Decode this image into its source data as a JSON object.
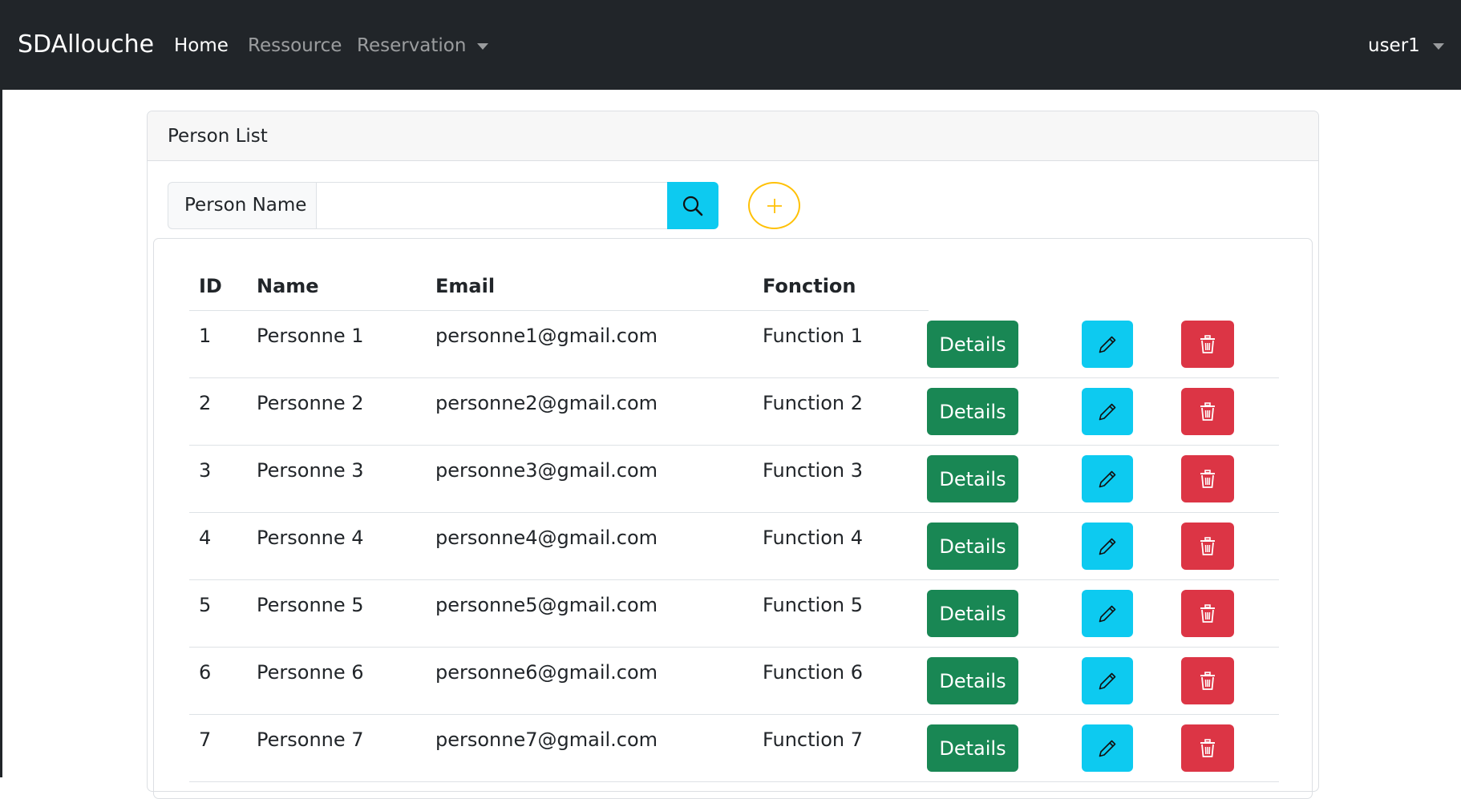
{
  "navbar": {
    "brand": "SDAllouche",
    "links": [
      {
        "label": "Home",
        "active": true
      },
      {
        "label": "Ressource",
        "active": false
      },
      {
        "label": "Reservation",
        "active": false,
        "dropdown": true
      }
    ],
    "user": "user1"
  },
  "card": {
    "title": "Person List",
    "search": {
      "label": "Person Name",
      "value": "",
      "button_icon": "search-icon"
    },
    "add_icon": "plus-icon"
  },
  "table": {
    "headers": [
      "ID",
      "Name",
      "Email",
      "Fonction"
    ],
    "rows": [
      {
        "id": "1",
        "name": "Personne 1",
        "email": "personne1@gmail.com",
        "fonction": "Function 1"
      },
      {
        "id": "2",
        "name": "Personne 2",
        "email": "personne2@gmail.com",
        "fonction": "Function 2"
      },
      {
        "id": "3",
        "name": "Personne 3",
        "email": "personne3@gmail.com",
        "fonction": "Function 3"
      },
      {
        "id": "4",
        "name": "Personne 4",
        "email": "personne4@gmail.com",
        "fonction": "Function 4"
      },
      {
        "id": "5",
        "name": "Personne 5",
        "email": "personne5@gmail.com",
        "fonction": "Function 5"
      },
      {
        "id": "6",
        "name": "Personne 6",
        "email": "personne6@gmail.com",
        "fonction": "Function 6"
      },
      {
        "id": "7",
        "name": "Personne 7",
        "email": "personne7@gmail.com",
        "fonction": "Function 7"
      }
    ],
    "details_label": "Details",
    "edit_icon": "pencil-icon",
    "delete_icon": "trash-icon"
  },
  "colors": {
    "navbar_bg": "#212529",
    "details": "#198754",
    "edit": "#0dcaf0",
    "delete": "#dc3545",
    "add_outline": "#ffc107"
  }
}
